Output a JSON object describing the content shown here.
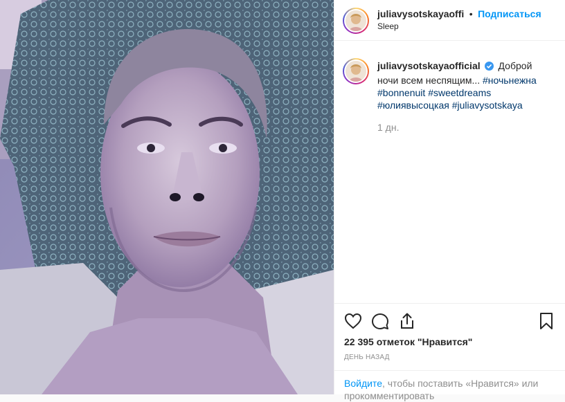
{
  "header": {
    "username": "juliavysotskayaoffi",
    "separator": "•",
    "follow_label": "Подписаться",
    "location": "Sleep"
  },
  "caption": {
    "username": "juliavysotskayaofficial",
    "verified_icon": "verified-badge-icon",
    "line1": "Доброй",
    "line2_text": "ночи всем неспящим... ",
    "tag1": "#ночьнежна",
    "tag2": "#bonnenuit",
    "tag3": "#sweetdreams",
    "tag4": "#юлиявысоцкая",
    "tag5": "#juliavysotskaya",
    "time": "1 дн."
  },
  "actions": {
    "like_icon": "heart-icon",
    "comment_icon": "comment-icon",
    "share_icon": "share-icon",
    "save_icon": "bookmark-icon"
  },
  "likes": {
    "text": "22 395 отметок \"Нравится\""
  },
  "posted": {
    "text": "ДЕНЬ НАЗАД"
  },
  "login_prompt": {
    "link": "Войдите",
    "text": ", чтобы поставить «Нравится» или",
    "text2": "прокомментировать"
  },
  "colors": {
    "follow": "#0095f6",
    "verified": "#3897f0",
    "hashtag": "#00376b"
  }
}
